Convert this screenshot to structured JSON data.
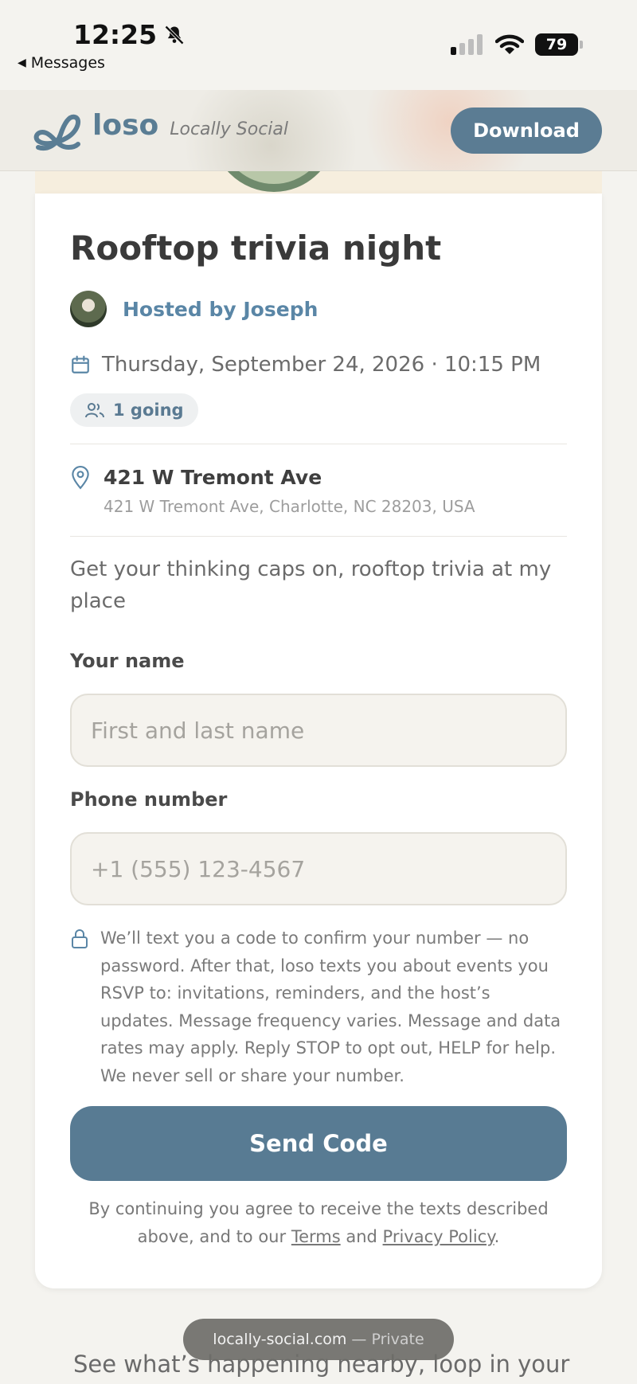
{
  "status_bar": {
    "time": "12:25",
    "back_label": "Messages",
    "battery": "79"
  },
  "header": {
    "brand_name": "loso",
    "brand_tagline": "Locally Social",
    "download_label": "Download"
  },
  "event": {
    "title": "Rooftop trivia night",
    "host_label": "Hosted by Joseph",
    "datetime": "Thursday, September 24, 2026 · 10:15 PM",
    "going_label": "1 going",
    "location_name": "421 W Tremont Ave",
    "location_address": "421 W Tremont Ave, Charlotte, NC 28203, USA",
    "description": "Get your thinking caps on, rooftop trivia at my place"
  },
  "form": {
    "name_label": "Your name",
    "name_placeholder": "First and last name",
    "phone_label": "Phone number",
    "phone_placeholder": "+1 (555) 123-4567",
    "notice": "We’ll text you a code to confirm your number — no password. After that, loso texts you about events you RSVP to: invitations, reminders, and the host’s updates. Message frequency varies. Message and data rates may apply. Reply STOP to opt out, HELP for help. We never sell or share your number.",
    "submit_label": "Send Code",
    "legal_prefix": "By continuing you agree to receive the texts described above, and to our",
    "terms_label": "Terms",
    "legal_and": "and",
    "privacy_label": "Privacy Policy",
    "legal_suffix": "."
  },
  "footer": {
    "teaser": "See what’s happening nearby, loop in your",
    "url": "locally-social.com",
    "url_mode": "— Private"
  },
  "colors": {
    "accent": "#5b7c93",
    "host_link": "#5a86a6",
    "background": "#f4f3ef"
  }
}
